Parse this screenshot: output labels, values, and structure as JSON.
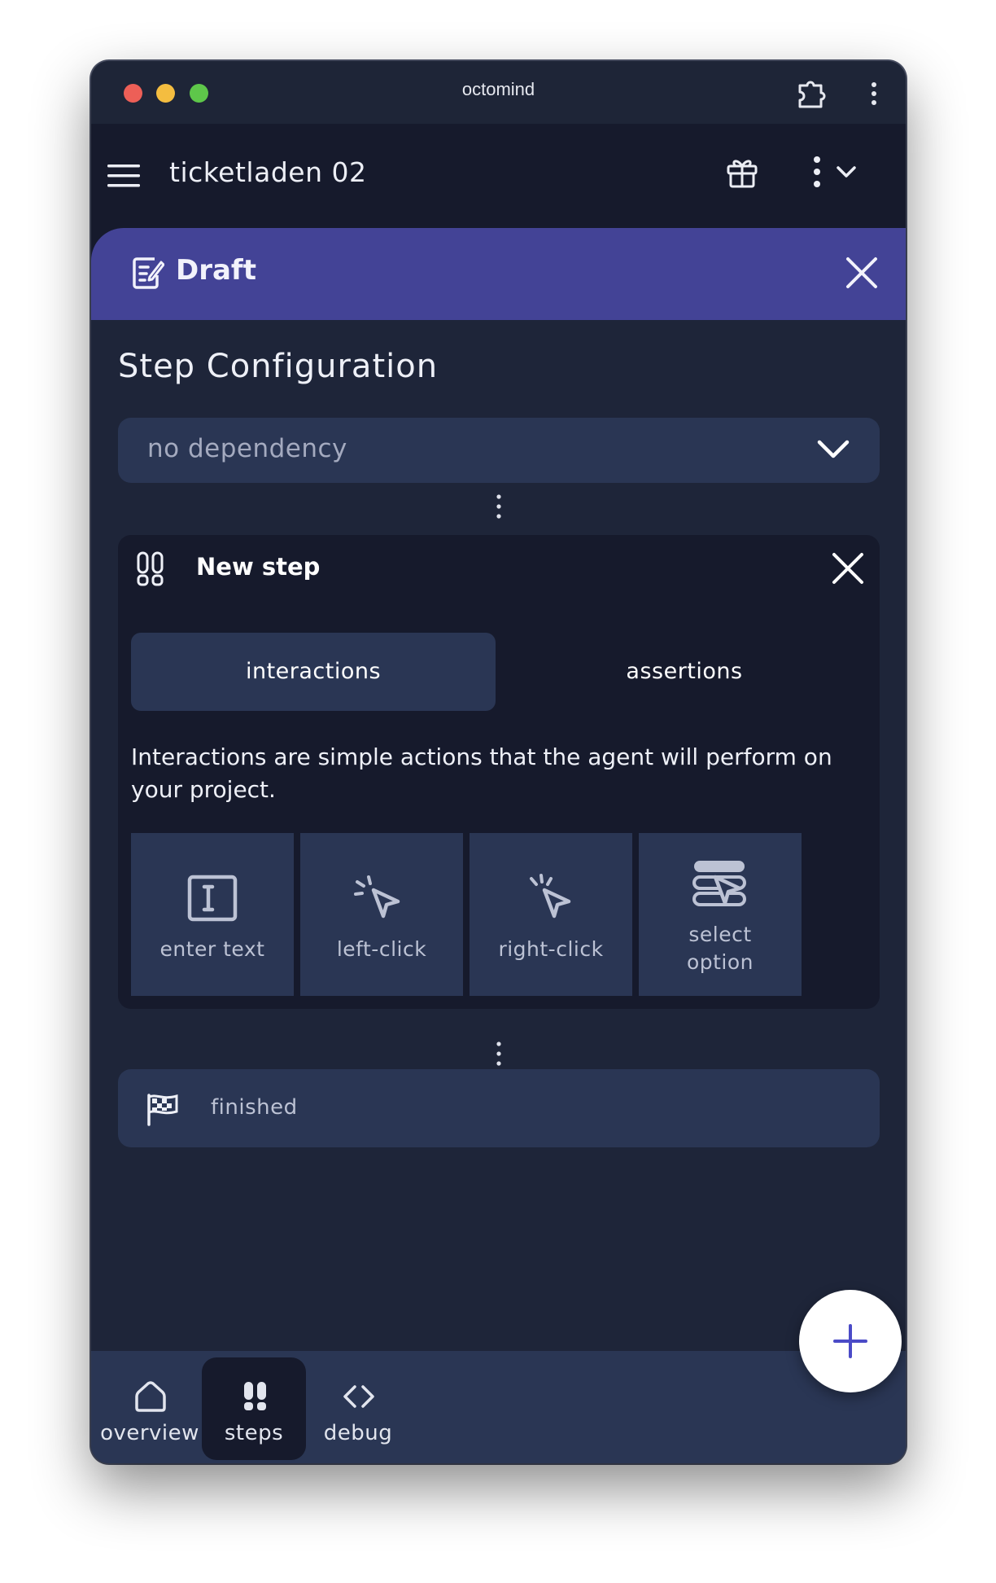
{
  "window": {
    "title": "octomind"
  },
  "header": {
    "project_name": "ticketladen 02"
  },
  "draft": {
    "label": "Draft"
  },
  "step_configuration": {
    "title": "Step Configuration",
    "dependency_value": "no dependency"
  },
  "new_step": {
    "title": "New step",
    "tabs": [
      {
        "label": "interactions",
        "active": true
      },
      {
        "label": "assertions",
        "active": false
      }
    ],
    "description": "Interactions are simple actions that the agent will perform on your project.",
    "actions": [
      {
        "label": "enter text",
        "icon": "text-cursor-icon"
      },
      {
        "label": "left-click",
        "icon": "left-click-icon"
      },
      {
        "label": "right-click",
        "icon": "right-click-icon"
      },
      {
        "label": "select option",
        "icon": "select-option-icon"
      }
    ]
  },
  "finished": {
    "label": "finished"
  },
  "bottom_nav": [
    {
      "label": "overview",
      "icon": "home-icon",
      "active": false
    },
    {
      "label": "steps",
      "icon": "footsteps-icon",
      "active": true
    },
    {
      "label": "debug",
      "icon": "code-icon",
      "active": false
    }
  ],
  "colors": {
    "accent": "#434396",
    "background": "#1e2539",
    "card": "#161a2c",
    "surface": "#2a3654",
    "fab_plus": "#4b4bc7"
  }
}
